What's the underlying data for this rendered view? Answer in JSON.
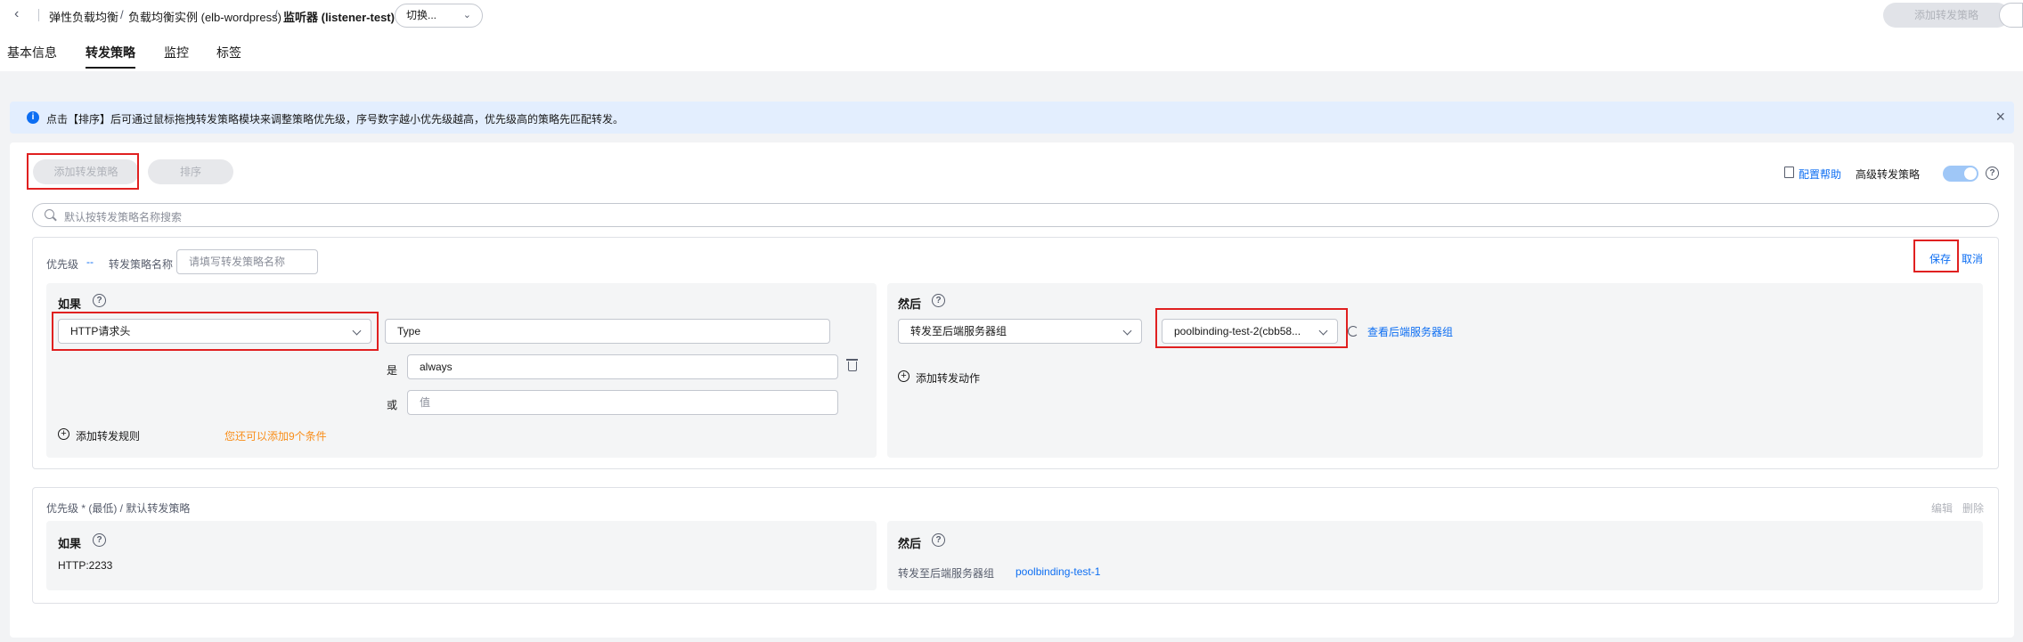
{
  "header": {
    "breadcrumb": [
      "弹性负载均衡",
      "负载均衡实例 (elb-wordpress)",
      "监听器 (listener-test)"
    ],
    "separator": "/",
    "switch_label": "切换...",
    "add_policy_label": "添加转发策略"
  },
  "tabs": [
    "基本信息",
    "转发策略",
    "监控",
    "标签"
  ],
  "active_tab": "转发策略",
  "alert": {
    "text": "点击【排序】后可通过鼠标拖拽转发策略模块来调整策略优先级，序号数字越小优先级越高，优先级高的策略先匹配转发。"
  },
  "toolbar": {
    "add_policy_label": "添加转发策略",
    "sort_label": "排序",
    "config_help_label": "配置帮助",
    "advanced_label": "高级转发策略",
    "advanced_enabled": true
  },
  "search": {
    "placeholder": "默认按转发策略名称搜索"
  },
  "edit_policy": {
    "priority_label": "优先级",
    "priority_value": "--",
    "name_label": "转发策略名称",
    "name_placeholder": "请填写转发策略名称",
    "save_label": "保存",
    "cancel_label": "取消",
    "if": {
      "title": "如果",
      "condition_type": "HTTP请求头",
      "header_key": "Type",
      "is_label": "是",
      "is_value": "always",
      "or_label": "或",
      "or_placeholder": "值",
      "add_rule_label": "添加转发规则",
      "remaining_hint": "您还可以添加9个条件"
    },
    "then": {
      "title": "然后",
      "action_type": "转发至后端服务器组",
      "server_group": "poolbinding-test-2(cbb58...",
      "view_group_label": "查看后端服务器组",
      "add_action_label": "添加转发动作"
    }
  },
  "default_policy": {
    "header_label": "优先级 * (最低) / 默认转发策略",
    "edit_label": "编辑",
    "delete_label": "删除",
    "if": {
      "title": "如果",
      "value": "HTTP:2233"
    },
    "then": {
      "title": "然后",
      "action_label": "转发至后端服务器组",
      "server_group": "poolbinding-test-1"
    }
  },
  "colors": {
    "accent": "#0d6ef2",
    "warning": "#f98e1a",
    "highlight_box": "#e02020",
    "alert_bg": "#e3eefe"
  }
}
